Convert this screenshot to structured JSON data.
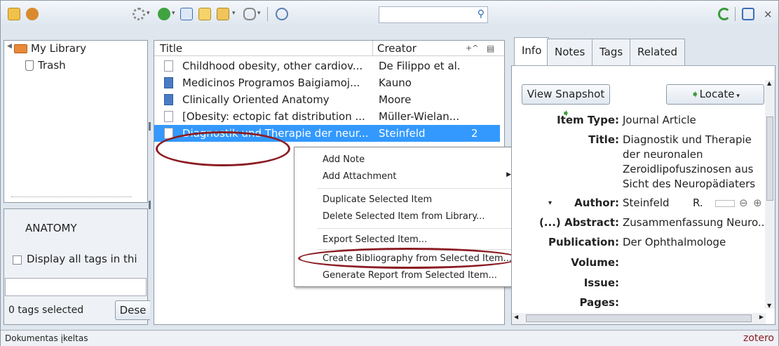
{
  "search": {
    "placeholder": ""
  },
  "library": {
    "root": "My Library",
    "trash": "Trash"
  },
  "tag_pane": {
    "tag": "ANATOMY",
    "display_all": "Display all tags in thi",
    "selected": "0 tags selected",
    "deselect": "Dese"
  },
  "columns": {
    "title": "Title",
    "creator": "Creator",
    "more": "+^"
  },
  "items": [
    {
      "title": "Childhood obesity, other cardiov...",
      "creator": "De Filippo et al.",
      "icon": "document-icon",
      "count": ""
    },
    {
      "title": "Medicinos Programos Baigiamoj...",
      "creator": "Kauno",
      "icon": "book-icon",
      "count": ""
    },
    {
      "title": "Clinically Oriented Anatomy",
      "creator": "Moore",
      "icon": "book-icon",
      "count": ""
    },
    {
      "title": "[Obesity: ectopic fat distribution ...",
      "creator": "Müller-Wielan...",
      "icon": "document-icon",
      "count": ""
    },
    {
      "title": "Diagnostik und Therapie der neur...",
      "creator": "Steinfeld",
      "icon": "document-icon",
      "count": "2"
    }
  ],
  "context_menu": {
    "add_note": "Add Note",
    "add_attachment": "Add Attachment",
    "duplicate": "Duplicate Selected Item",
    "delete": "Delete Selected Item from Library...",
    "export": "Export Selected Item...",
    "bibliography": "Create Bibliography from Selected Item...",
    "report": "Generate Report from Selected Item..."
  },
  "tabs": {
    "info": "Info",
    "notes": "Notes",
    "tags": "Tags",
    "related": "Related"
  },
  "buttons": {
    "snapshot": "View Snapshot",
    "locate": "Locate"
  },
  "info": {
    "item_type_label": "Item Type:",
    "item_type": "Journal Article",
    "title_label": "Title:",
    "title_1": "Diagnostik und Therapie",
    "title_2": "der neuronalen",
    "title_3": "Zeroidlipofuszinosen aus",
    "title_4": "Sicht des Neuropädiaters",
    "author_label": "Author:",
    "author_last": "Steinfeld",
    "author_first": "R.",
    "abstract_label": "(...) Abstract:",
    "abstract": "Zusammenfassung  Neuro...",
    "publication_label": "Publication:",
    "publication": "Der Ophthalmologe",
    "volume_label": "Volume:",
    "issue_label": "Issue:",
    "pages_label": "Pages:"
  },
  "status": {
    "left": "Dokumentas įkeltas",
    "brand": "zotero"
  },
  "colors": {
    "selection": "#3399ff",
    "annotation": "#8b1c23"
  }
}
